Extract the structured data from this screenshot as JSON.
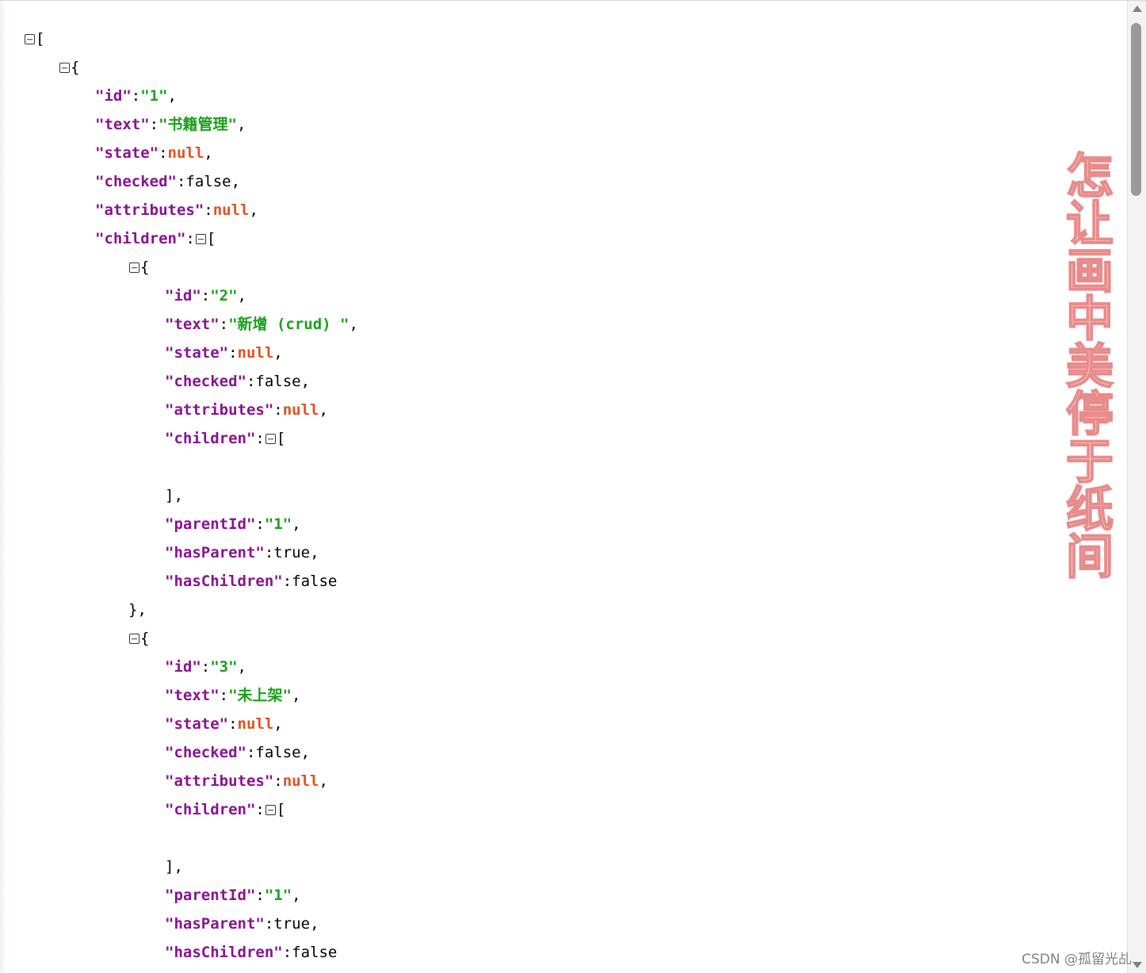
{
  "json_viewer": {
    "root_open": "[",
    "obj_open": "{",
    "obj_close": "},",
    "arr_close": "],",
    "colon": ":",
    "comma": ",",
    "root": {
      "id_key": "\"id\"",
      "id_val": "\"1\"",
      "text_key": "\"text\"",
      "text_val": "\"书籍管理\"",
      "state_key": "\"state\"",
      "state_val": "null",
      "checked_key": "\"checked\"",
      "checked_val": "false",
      "attributes_key": "\"attributes\"",
      "attributes_val": "null",
      "children_key": "\"children\""
    },
    "children": [
      {
        "id_key": "\"id\"",
        "id_val": "\"2\"",
        "text_key": "\"text\"",
        "text_val": "\"新增 (crud) \"",
        "state_key": "\"state\"",
        "state_val": "null",
        "checked_key": "\"checked\"",
        "checked_val": "false",
        "attributes_key": "\"attributes\"",
        "attributes_val": "null",
        "children_key": "\"children\"",
        "parentId_key": "\"parentId\"",
        "parentId_val": "\"1\"",
        "hasParent_key": "\"hasParent\"",
        "hasParent_val": "true",
        "hasChildren_key": "\"hasChildren\"",
        "hasChildren_val": "false"
      },
      {
        "id_key": "\"id\"",
        "id_val": "\"3\"",
        "text_key": "\"text\"",
        "text_val": "\"未上架\"",
        "state_key": "\"state\"",
        "state_val": "null",
        "checked_key": "\"checked\"",
        "checked_val": "false",
        "attributes_key": "\"attributes\"",
        "attributes_val": "null",
        "children_key": "\"children\"",
        "parentId_key": "\"parentId\"",
        "parentId_val": "\"1\"",
        "hasParent_key": "\"hasParent\"",
        "hasParent_val": "true",
        "hasChildren_key": "\"hasChildren\"",
        "hasChildren_val": "false"
      }
    ]
  },
  "watermark": {
    "text": "怎让画中美停于纸间"
  },
  "credit": {
    "text": "CSDN @孤留光乩"
  },
  "colors": {
    "key": "#881391",
    "string": "#1aa01a",
    "null": "#e0521f"
  }
}
